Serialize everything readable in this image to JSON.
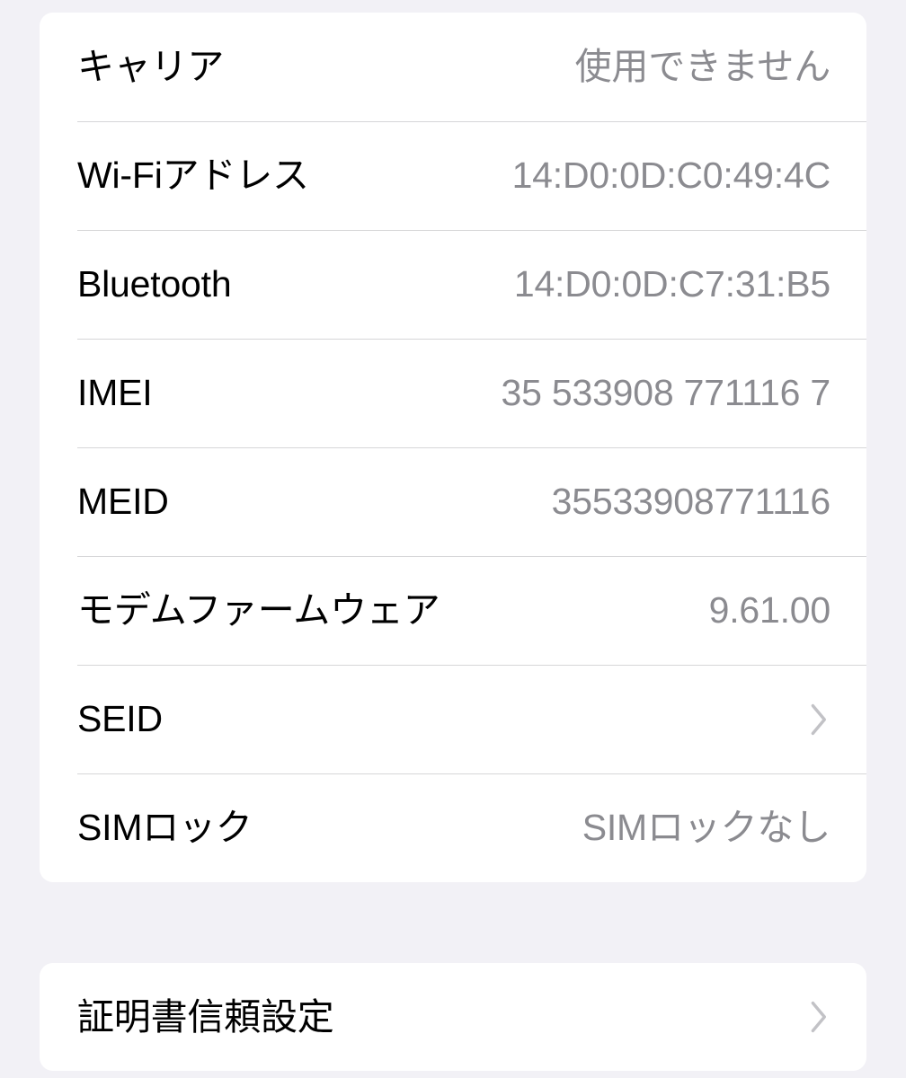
{
  "theme": {
    "background": "#f2f1f6",
    "card_background": "#ffffff",
    "label_color": "#000000",
    "value_color": "#8b8b90",
    "separator_color": "#d6d6d8",
    "chevron_color": "#c2c2c6"
  },
  "sections": [
    {
      "name": "device-info",
      "rows": [
        {
          "label": "キャリア",
          "value": "使用できません",
          "accessory": "none"
        },
        {
          "label": "Wi-Fiアドレス",
          "value": "14:D0:0D:C0:49:4C",
          "accessory": "none"
        },
        {
          "label": "Bluetooth",
          "value": "14:D0:0D:C7:31:B5",
          "accessory": "none"
        },
        {
          "label": "IMEI",
          "value": "35 533908 771116 7",
          "accessory": "none"
        },
        {
          "label": "MEID",
          "value": "35533908771116",
          "accessory": "none"
        },
        {
          "label": "モデムファームウェア",
          "value": "9.61.00",
          "accessory": "none"
        },
        {
          "label": "SEID",
          "value": "",
          "accessory": "chevron-right-icon"
        },
        {
          "label": "SIMロック",
          "value": "SIMロックなし",
          "accessory": "none"
        }
      ]
    },
    {
      "name": "certificate-trust",
      "rows": [
        {
          "label": "証明書信頼設定",
          "value": "",
          "accessory": "chevron-right-icon"
        }
      ]
    }
  ]
}
